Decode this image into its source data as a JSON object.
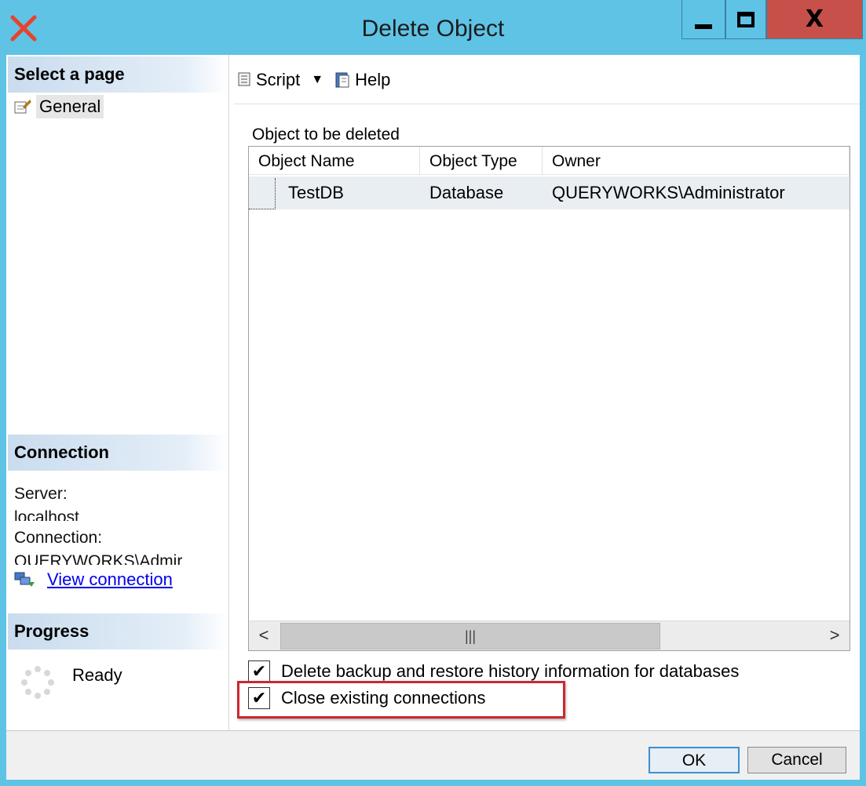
{
  "window": {
    "title": "Delete Object"
  },
  "left_pane": {
    "select_page_header": "Select a page",
    "pages": [
      {
        "label": "General"
      }
    ],
    "connection_header": "Connection",
    "server_label": "Server:",
    "server_value": "localhost",
    "connection_label": "Connection:",
    "connection_value": "QUERYWORKS\\Admir",
    "view_connection_link": "View connection",
    "progress_header": "Progress",
    "progress_status": "Ready"
  },
  "toolbar": {
    "script_label": "Script",
    "help_label": "Help"
  },
  "objects": {
    "list_label": "Object to be deleted",
    "columns": [
      "Object Name",
      "Object Type",
      "Owner"
    ],
    "rows": [
      {
        "name": "TestDB",
        "type": "Database",
        "owner": "QUERYWORKS\\Administrator"
      }
    ]
  },
  "options": {
    "delete_backup": {
      "label": "Delete backup and restore history information for databases",
      "checked": true
    },
    "close_connections": {
      "label": "Close existing connections",
      "checked": true
    }
  },
  "buttons": {
    "ok": "OK",
    "cancel": "Cancel"
  },
  "colors": {
    "titlebar": "#5fc3e6",
    "close_button": "#c7504a",
    "highlight": "#c9292e",
    "link": "#0000ee"
  }
}
